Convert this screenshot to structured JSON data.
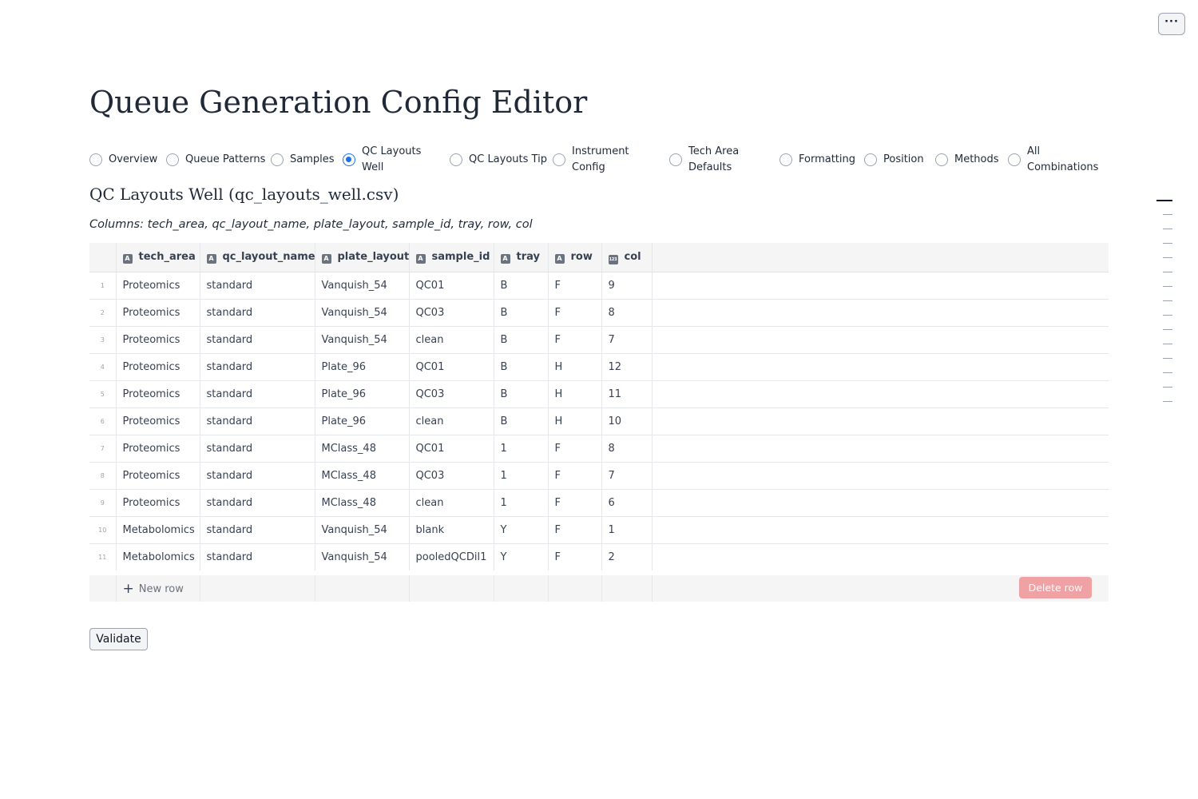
{
  "menu_label": "···",
  "title": "Queue Generation Config Editor",
  "tabs": [
    {
      "label": "Overview",
      "selected": false
    },
    {
      "label": "Queue Patterns",
      "selected": false
    },
    {
      "label": "Samples",
      "selected": false
    },
    {
      "label": "QC Layouts Well",
      "selected": true
    },
    {
      "label": "QC Layouts Tip",
      "selected": false
    },
    {
      "label": "Instrument Config",
      "selected": false
    },
    {
      "label": "Tech Area Defaults",
      "selected": false
    },
    {
      "label": "Formatting",
      "selected": false
    },
    {
      "label": "Position",
      "selected": false
    },
    {
      "label": "Methods",
      "selected": false
    },
    {
      "label": "All Combinations",
      "selected": false
    }
  ],
  "section_title": "QC Layouts Well (qc_layouts_well.csv)",
  "columns_note": "Columns: tech_area, qc_layout_name, plate_layout, sample_id, tray, row, col",
  "table": {
    "columns": [
      {
        "name": "tech_area",
        "type_icon": "A"
      },
      {
        "name": "qc_layout_name",
        "type_icon": "A"
      },
      {
        "name": "plate_layout",
        "type_icon": "A"
      },
      {
        "name": "sample_id",
        "type_icon": "A"
      },
      {
        "name": "tray",
        "type_icon": "A"
      },
      {
        "name": "row",
        "type_icon": "A"
      },
      {
        "name": "col",
        "type_icon": "123"
      }
    ],
    "rows": [
      [
        "1",
        "Proteomics",
        "standard",
        "Vanquish_54",
        "QC01",
        "B",
        "F",
        "9"
      ],
      [
        "2",
        "Proteomics",
        "standard",
        "Vanquish_54",
        "QC03",
        "B",
        "F",
        "8"
      ],
      [
        "3",
        "Proteomics",
        "standard",
        "Vanquish_54",
        "clean",
        "B",
        "F",
        "7"
      ],
      [
        "4",
        "Proteomics",
        "standard",
        "Plate_96",
        "QC01",
        "B",
        "H",
        "12"
      ],
      [
        "5",
        "Proteomics",
        "standard",
        "Plate_96",
        "QC03",
        "B",
        "H",
        "11"
      ],
      [
        "6",
        "Proteomics",
        "standard",
        "Plate_96",
        "clean",
        "B",
        "H",
        "10"
      ],
      [
        "7",
        "Proteomics",
        "standard",
        "MClass_48",
        "QC01",
        "1",
        "F",
        "8"
      ],
      [
        "8",
        "Proteomics",
        "standard",
        "MClass_48",
        "QC03",
        "1",
        "F",
        "7"
      ],
      [
        "9",
        "Proteomics",
        "standard",
        "MClass_48",
        "clean",
        "1",
        "F",
        "6"
      ],
      [
        "10",
        "Metabolomics",
        "standard",
        "Vanquish_54",
        "blank",
        "Y",
        "F",
        "1"
      ],
      [
        "11",
        "Metabolomics",
        "standard",
        "Vanquish_54",
        "pooledQCDil1",
        "Y",
        "F",
        "2"
      ]
    ],
    "new_row_label": "New row",
    "delete_row_label": "Delete row"
  },
  "validate_label": "Validate",
  "colors": {
    "accent": "#1a73e8",
    "delete_button": "#f0a1a4",
    "header_bg": "#f5f5f5"
  },
  "icons": {
    "menu": "ellipsis-icon",
    "new_row": "plus-icon",
    "text_column": "text-type-icon",
    "number_column": "number-type-icon"
  }
}
